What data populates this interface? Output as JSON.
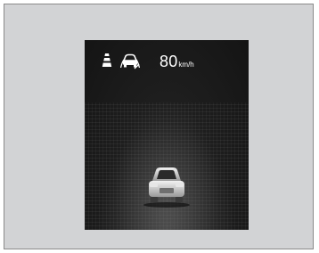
{
  "display": {
    "icons": [
      "lane-keeping-icon",
      "steering-assist-icon"
    ],
    "speed": {
      "value": "80",
      "unit": "km/h"
    },
    "vehicle": "lead-car-icon"
  }
}
